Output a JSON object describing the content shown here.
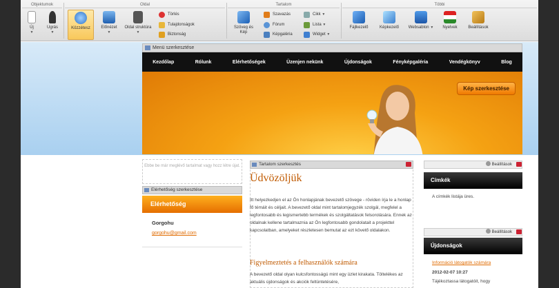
{
  "ribbon": {
    "groups": [
      "Objektumok",
      "Oldal",
      "Tartalom",
      "Többi"
    ],
    "buttons": {
      "new": "Új",
      "jump": "Ugrás",
      "publish": "Közzétesz",
      "preview": "Előnézet",
      "page_structure": "Oldal struktúra",
      "delete": "Törlés",
      "properties": "Tulajdonságok",
      "security": "Biztonság",
      "text_image": "Szöveg és Kép",
      "words": "Szavazás",
      "forum": "Fórum",
      "gallery": "Képgaléria",
      "article": "Cikk",
      "list": "Lista",
      "widget": "Widget",
      "file_manager": "Fájlkezelő",
      "image_manager": "Képkezelő",
      "web_template": "Websablon",
      "languages": "Nyelvek",
      "settings": "Beállítások"
    }
  },
  "menu_edit": "Menü szerkesztése",
  "nav": [
    "Kezdőlap",
    "Rólunk",
    "Elérhetőségek",
    "Üzenjen nekünk",
    "Újdonságok",
    "Fényképgaléria",
    "Vendégkönyv",
    "Blog"
  ],
  "hero_button": "Kép szerkesztése",
  "left": {
    "ghost_text": "Ebbe be már meglévő tartalmat vagy hozz létre újat.",
    "contact_edit": "Elérhetőség szerkesztése",
    "contact_title": "Elérhetőség",
    "name": "Gorgohu",
    "email": "gorgohu@gmail.com"
  },
  "center": {
    "edit_bar": "Tartalom szerkesztés",
    "title": "Üdvözöljük",
    "intro": "Itt helyezkedjen el az Ön honlapjának bevezető szövege - röviden írja le a honlap fő témáit és céljait. A bevezető oldal mint tartalomjegyzék szolgál, megfelel a legfontosabb és legismertebb termékek és szolgáltatások felsorolására. Ennek az oldalnak kellene tartalmaznia az Ön legfontosabb gondolatait a projekttel kapcsolatban, amelyeket részletesen bemutat az ezt követő oldalakon.",
    "warning_title": "Figyelmeztetés a felhasználók számára",
    "warning_text": "A bevezető oldal olyan kulcsfontosságú mint egy üzlet kirakata. Töltelékes az aktuális újdonságok és akciók feltüntetésére,"
  },
  "right": {
    "settings_label": "Beállítások",
    "tags_title": "Címkék",
    "tags_empty": "A címkék listája üres.",
    "news_title": "Újdonságok",
    "news_link": "Információ látogatók számára",
    "news_date": "2012-02-07 10:27",
    "news_text": "Tájékoztassa látogatóit, hogy"
  }
}
